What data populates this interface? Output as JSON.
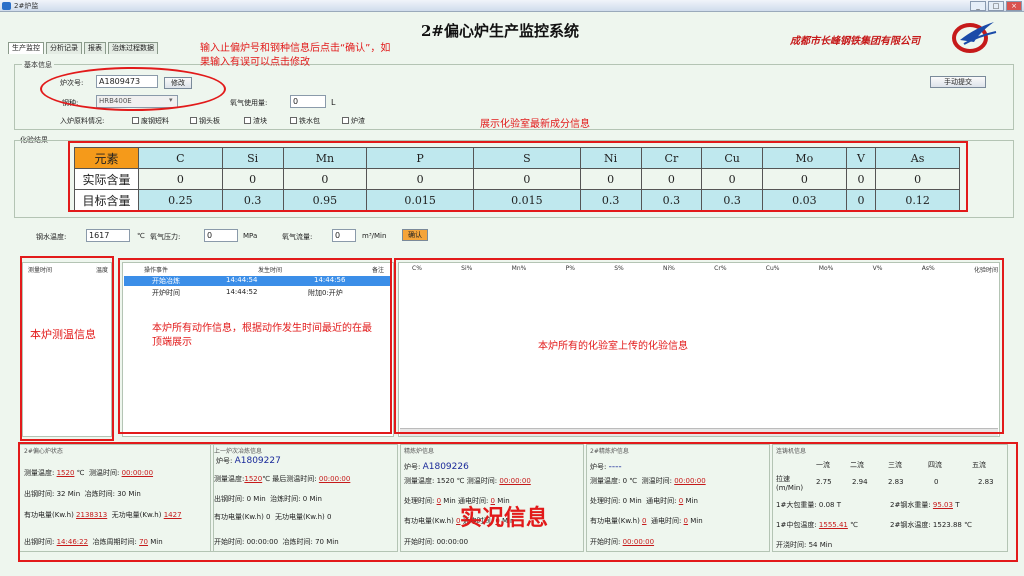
{
  "window": {
    "title": "2#炉监"
  },
  "header": {
    "title": "2#偏心炉生产监控系统",
    "company": "成都市长峰钢铁集团有限公司"
  },
  "tabs": [
    "生产监控",
    "分析记录",
    "报表",
    "治炼过程数据"
  ],
  "annotations": {
    "input_info": "输入止偏炉号和钢种信息后点击“确认”，如果输入有误可以点击修改",
    "lab_info": "展示化验室最新成分信息",
    "temp_info": "本炉测温信息",
    "actions_info": "本炉所有动作信息，根据动作发生时间最近的在最顶端展示",
    "lab_all_info": "本炉所有的化验室上传的化验信息",
    "live_info": "实况信息"
  },
  "basic_info": {
    "group_label": "基本信息",
    "furnace_no_label": "炉次号:",
    "furnace_no_value": "A1809473",
    "confirm_button": "修改",
    "steel_label": "钢种:",
    "steel_value": "HRB400E",
    "oxygen_label": "氧气使用量:",
    "oxygen_value": "0",
    "oxygen_unit": "L",
    "charge_label": "入炉原料情况:",
    "checkboxes": [
      "废钢短料",
      "钢头板",
      "渣块",
      "铁水包",
      "炉渣"
    ],
    "manual_button": "手动提交"
  },
  "chem_table": {
    "group_label": "化验结果",
    "row_labels": [
      "元素",
      "实际含量",
      "目标含量"
    ],
    "elements": [
      "C",
      "Si",
      "Mn",
      "P",
      "S",
      "Ni",
      "Cr",
      "Cu",
      "Mo",
      "V",
      "As"
    ],
    "actual": [
      "0",
      "0",
      "0",
      "0",
      "0",
      "0",
      "0",
      "0",
      "0",
      "0",
      "0"
    ],
    "target": [
      "0.25",
      "0.3",
      "0.95",
      "0.015",
      "0.015",
      "0.3",
      "0.3",
      "0.3",
      "0.03",
      "0",
      "0.12"
    ]
  },
  "measure": {
    "temp_label": "钢水温度:",
    "temp_value": "1617",
    "temp_unit": "℃",
    "pressure_label": "氧气压力:",
    "pressure_value": "0",
    "pressure_unit": "MPa",
    "flow_label": "氧气流量:",
    "flow_value": "0",
    "flow_unit": "m³/Min",
    "small_button": "确认"
  },
  "temp_list": {
    "headers": [
      "测量时间",
      "温度"
    ]
  },
  "action_list": {
    "headers": [
      "操作事件",
      "发生时间",
      "备注"
    ],
    "rows": [
      {
        "event": "开始冶炼",
        "time": "14:44:54",
        "note": "14:44:56",
        "selected": true
      },
      {
        "event": "开炉时间",
        "time": "14:44:52",
        "note": "附加0:开炉",
        "selected": false
      }
    ]
  },
  "lab_list": {
    "headers": [
      "C%",
      "Si%",
      "Mn%",
      "P%",
      "S%",
      "Ni%",
      "Cr%",
      "Cu%",
      "Mo%",
      "V%",
      "As%",
      "化验时间"
    ]
  },
  "live": {
    "s1": {
      "title": "2#偏心炉状态",
      "lines": [
        [
          "测量温度:",
          "1520",
          "℃",
          "测温时间:",
          "00:00:00"
        ],
        [
          "出钢时间:",
          "32",
          "Min",
          "冶炼时间:",
          "30",
          "Min"
        ],
        [
          "有功电量(Kw.h)",
          "2138313",
          "",
          "无功电量(Kw.h)",
          "1427"
        ],
        [
          "出钢时间:",
          "14:46:22",
          "",
          "冶炼周期时间:",
          "70",
          "Min"
        ]
      ]
    },
    "s2": {
      "title": "上一炉次冶炼信息",
      "furnace_label": "炉号:",
      "furnace": "A1809227",
      "lines": [
        [
          "测量温度:",
          "1520",
          "℃",
          "最后测温时间:",
          "00:00:00"
        ],
        [
          "出钢时间:",
          "0",
          "Min",
          "治炼时间:",
          "0",
          "Min"
        ],
        [
          "有功电量(Kw.h)",
          "0",
          "",
          "无功电量(Kw.h)",
          "0"
        ],
        [
          "开始时间:",
          "00:00:00",
          "",
          "冶炼时间:",
          "70",
          "Min"
        ]
      ]
    },
    "s3": {
      "title": "精炼炉信息",
      "furnace_label": "炉号:",
      "furnace": "A1809226",
      "lines": [
        [
          "测量温度:",
          "1520",
          "℃",
          "测温时间:",
          "00:00:00"
        ],
        [
          "处理时间:",
          "0",
          "Min",
          "通电时间:",
          "0",
          "Min"
        ],
        [
          "有功电量(Kw.h)",
          "0",
          "",
          "通电时间:",
          "0",
          "Min"
        ],
        [
          "开始时间:",
          "00:00:00"
        ]
      ]
    },
    "s4": {
      "title": "2#精炼炉信息",
      "furnace_label": "炉号:",
      "furnace": "----",
      "lines": [
        [
          "测量温度:",
          "0",
          "℃",
          "测温时间:",
          "00:00:00"
        ],
        [
          "处理时间:",
          "0",
          "Min",
          "通电时间:",
          "0",
          "Min"
        ],
        [
          "有功电量(Kw.h)",
          "0",
          "",
          "通电时间:",
          "0",
          "Min"
        ],
        [
          "开始时间:",
          "00:00:00"
        ]
      ]
    },
    "s5": {
      "title": "连铸机信息",
      "flows": [
        "一流",
        "二流",
        "三流",
        "四流",
        "五流"
      ],
      "speed_label": "拉速(m/Min)",
      "speeds": [
        "2.75",
        "2.94",
        "2.83",
        "0",
        "2.83"
      ],
      "weight_label": "1#大包重量:",
      "weight": "0.08",
      "weight_unit": "T",
      "casting_label": "2#钢水重量:",
      "casting": "95.03",
      "casting_unit": "T",
      "tundish_label": "1#中包温度:",
      "tundish": "1555.41",
      "tundish_unit": "℃",
      "tundish2_label": "2#钢水温度:",
      "tundish2": "1523.88",
      "tundish2_unit": "℃",
      "time_label": "开浇时间:",
      "time": "54",
      "time_unit": "Min"
    }
  }
}
